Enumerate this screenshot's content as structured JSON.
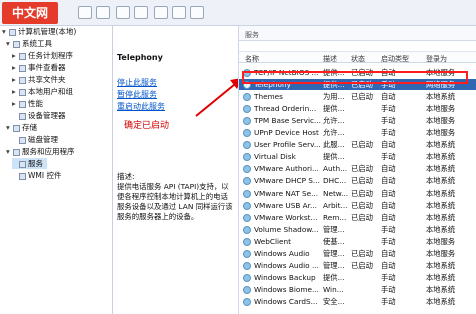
{
  "brand": {
    "logo_text": "中文网"
  },
  "tree": {
    "items": [
      {
        "label": "计算机管理(本地)"
      },
      {
        "label": "系统工具"
      },
      {
        "label": "任务计划程序"
      },
      {
        "label": "事件查看器"
      },
      {
        "label": "共享文件夹"
      },
      {
        "label": "本地用户和组"
      },
      {
        "label": "性能"
      },
      {
        "label": "设备管理器"
      },
      {
        "label": "存储"
      },
      {
        "label": "磁盘管理"
      },
      {
        "label": "服务和应用程序"
      },
      {
        "label": "服务"
      },
      {
        "label": "WMI 控件"
      }
    ]
  },
  "details": {
    "title": "Telephony",
    "actions": [
      "停止此服务",
      "暂停此服务",
      "重启动此服务"
    ],
    "description_label": "描述:",
    "description": "提供电话服务 API (TAPI)支持，以便各程序控制本地计算机上的电话服务设备以及通过 LAN 同样运行该服务的服务器上的设备。"
  },
  "annotation": "确定已启动",
  "services_panel": {
    "header_label": "服务",
    "columns": [
      "名称",
      "描述",
      "状态",
      "启动类型",
      "登录为"
    ],
    "rows": [
      {
        "name": "TCP/IP NetBIOS ...",
        "desc": "提供...",
        "status": "已启动",
        "startup": "自动",
        "logon": "本地服务"
      },
      {
        "name": "Telephony",
        "desc": "提供...",
        "status": "已启动",
        "startup": "手动",
        "logon": "网络服务"
      },
      {
        "name": "Themes",
        "desc": "为用...",
        "status": "已启动",
        "startup": "自动",
        "logon": "本地系统"
      },
      {
        "name": "Thread Orderin...",
        "desc": "提供...",
        "status": "",
        "startup": "手动",
        "logon": "本地服务"
      },
      {
        "name": "TPM Base Servic...",
        "desc": "允许...",
        "status": "",
        "startup": "手动",
        "logon": "本地服务"
      },
      {
        "name": "UPnP Device Host",
        "desc": "允许...",
        "status": "",
        "startup": "手动",
        "logon": "本地服务"
      },
      {
        "name": "User Profile Serv...",
        "desc": "此服...",
        "status": "已启动",
        "startup": "自动",
        "logon": "本地系统"
      },
      {
        "name": "Virtual Disk",
        "desc": "提供...",
        "status": "",
        "startup": "手动",
        "logon": "本地系统"
      },
      {
        "name": "VMware Authori...",
        "desc": "Auth...",
        "status": "已启动",
        "startup": "自动",
        "logon": "本地系统"
      },
      {
        "name": "VMware DHCP S...",
        "desc": "DHC...",
        "status": "已启动",
        "startup": "自动",
        "logon": "本地系统"
      },
      {
        "name": "VMware NAT Se...",
        "desc": "Netw...",
        "status": "已启动",
        "startup": "自动",
        "logon": "本地系统"
      },
      {
        "name": "VMware USB Ar...",
        "desc": "Arbit...",
        "status": "已启动",
        "startup": "自动",
        "logon": "本地系统"
      },
      {
        "name": "VMware Workst...",
        "desc": "Rem...",
        "status": "已启动",
        "startup": "自动",
        "logon": "本地系统"
      },
      {
        "name": "Volume Shadow...",
        "desc": "管理...",
        "status": "",
        "startup": "手动",
        "logon": "本地系统"
      },
      {
        "name": "WebClient",
        "desc": "使基...",
        "status": "",
        "startup": "手动",
        "logon": "本地服务"
      },
      {
        "name": "Windows Audio",
        "desc": "管理...",
        "status": "已启动",
        "startup": "自动",
        "logon": "本地服务"
      },
      {
        "name": "Windows Audio ...",
        "desc": "管理...",
        "status": "已启动",
        "startup": "自动",
        "logon": "本地系统"
      },
      {
        "name": "Windows Backup",
        "desc": "提供...",
        "status": "",
        "startup": "手动",
        "logon": "本地系统"
      },
      {
        "name": "Windows Biome...",
        "desc": "Win...",
        "status": "",
        "startup": "手动",
        "logon": "本地系统"
      },
      {
        "name": "Windows CardS...",
        "desc": "安全...",
        "status": "",
        "startup": "手动",
        "logon": "本地系统"
      }
    ]
  },
  "colors": {
    "accent": "#2f67b4",
    "highlight_box": "#ff1d1d",
    "annotation": "#d00000",
    "logo": "#e53b2a"
  }
}
